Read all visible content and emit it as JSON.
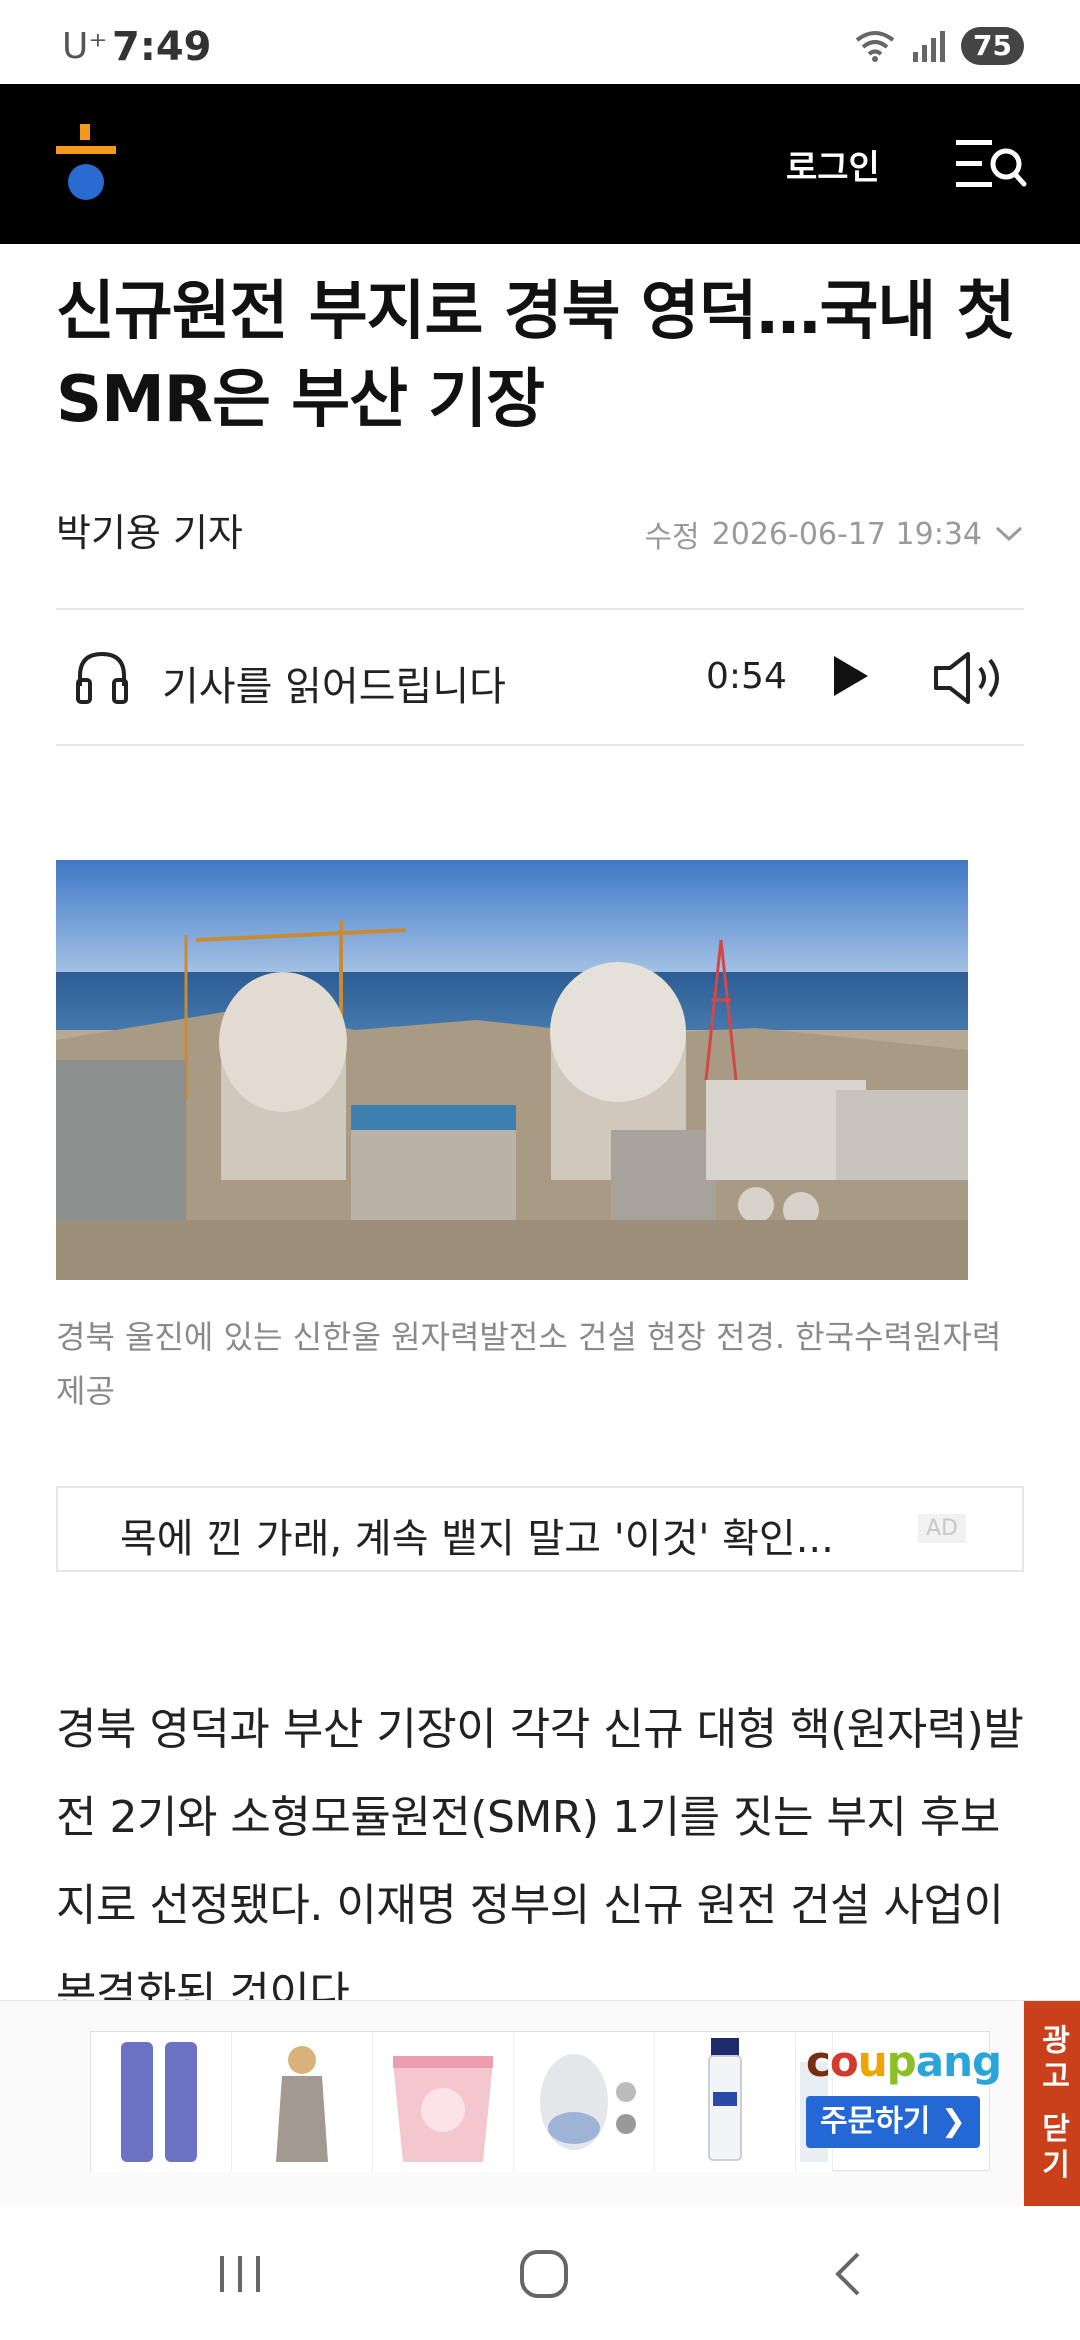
{
  "status_bar": {
    "carrier": "U⁺",
    "time": "7:49",
    "battery": "75"
  },
  "header": {
    "login_label": "로그인"
  },
  "article": {
    "title": "신규원전 부지로 경북 영덕…국내 첫 SMR은 부산 기장",
    "byline": "박기용 기자",
    "date_label": "수정",
    "date_value": "2026-06-17 19:34",
    "tts_label": "기사를 읽어드립니다",
    "tts_time": "0:54",
    "photo_caption": "경북 울진에 있는 신한울 원자력발전소 건설 현장 전경. 한국수력원자력 제공",
    "body": "경북 영덕과 부산 기장이 각각 신규 대형 핵(원자력)발전 2기와 소형모듈원전(SMR) 1기를 짓는 부지 후보지로 선정됐다. 이재명 정부의 신규 원전 건설 사업이 본격화된 것이다."
  },
  "native_ad": {
    "text": "목에 낀 가래, 계속 뱉지 말고 '이것' 확인...",
    "badge": "AD"
  },
  "bottom_ad": {
    "brand": "coupang",
    "cta": "주문하기 ❯",
    "close_label": "광고 닫기"
  },
  "colors": {
    "header_bg": "#000000",
    "accent_orange": "#f39a1e",
    "accent_blue": "#2a6bd1",
    "ad_close_bg": "#c9401b",
    "coupang_btn": "#2468d6"
  }
}
